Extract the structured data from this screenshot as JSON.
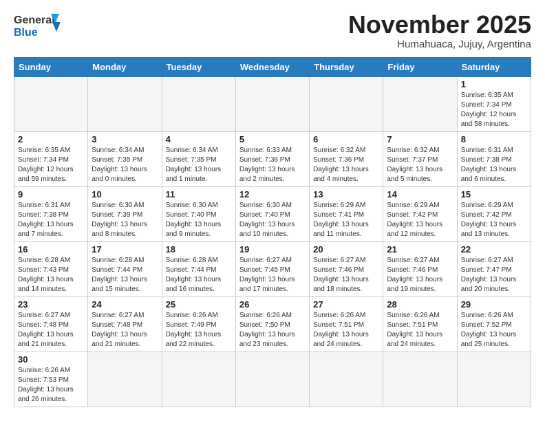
{
  "logo": {
    "line1": "General",
    "line2": "Blue"
  },
  "title": "November 2025",
  "subtitle": "Humahuaca, Jujuy, Argentina",
  "weekdays": [
    "Sunday",
    "Monday",
    "Tuesday",
    "Wednesday",
    "Thursday",
    "Friday",
    "Saturday"
  ],
  "weeks": [
    [
      {
        "day": "",
        "info": ""
      },
      {
        "day": "",
        "info": ""
      },
      {
        "day": "",
        "info": ""
      },
      {
        "day": "",
        "info": ""
      },
      {
        "day": "",
        "info": ""
      },
      {
        "day": "",
        "info": ""
      },
      {
        "day": "1",
        "info": "Sunrise: 6:35 AM\nSunset: 7:34 PM\nDaylight: 12 hours\nand 58 minutes."
      }
    ],
    [
      {
        "day": "2",
        "info": "Sunrise: 6:35 AM\nSunset: 7:34 PM\nDaylight: 12 hours\nand 59 minutes."
      },
      {
        "day": "3",
        "info": "Sunrise: 6:34 AM\nSunset: 7:35 PM\nDaylight: 13 hours\nand 0 minutes."
      },
      {
        "day": "4",
        "info": "Sunrise: 6:34 AM\nSunset: 7:35 PM\nDaylight: 13 hours\nand 1 minute."
      },
      {
        "day": "5",
        "info": "Sunrise: 6:33 AM\nSunset: 7:36 PM\nDaylight: 13 hours\nand 2 minutes."
      },
      {
        "day": "6",
        "info": "Sunrise: 6:32 AM\nSunset: 7:36 PM\nDaylight: 13 hours\nand 4 minutes."
      },
      {
        "day": "7",
        "info": "Sunrise: 6:32 AM\nSunset: 7:37 PM\nDaylight: 13 hours\nand 5 minutes."
      },
      {
        "day": "8",
        "info": "Sunrise: 6:31 AM\nSunset: 7:38 PM\nDaylight: 13 hours\nand 6 minutes."
      }
    ],
    [
      {
        "day": "9",
        "info": "Sunrise: 6:31 AM\nSunset: 7:38 PM\nDaylight: 13 hours\nand 7 minutes."
      },
      {
        "day": "10",
        "info": "Sunrise: 6:30 AM\nSunset: 7:39 PM\nDaylight: 13 hours\nand 8 minutes."
      },
      {
        "day": "11",
        "info": "Sunrise: 6:30 AM\nSunset: 7:40 PM\nDaylight: 13 hours\nand 9 minutes."
      },
      {
        "day": "12",
        "info": "Sunrise: 6:30 AM\nSunset: 7:40 PM\nDaylight: 13 hours\nand 10 minutes."
      },
      {
        "day": "13",
        "info": "Sunrise: 6:29 AM\nSunset: 7:41 PM\nDaylight: 13 hours\nand 11 minutes."
      },
      {
        "day": "14",
        "info": "Sunrise: 6:29 AM\nSunset: 7:42 PM\nDaylight: 13 hours\nand 12 minutes."
      },
      {
        "day": "15",
        "info": "Sunrise: 6:29 AM\nSunset: 7:42 PM\nDaylight: 13 hours\nand 13 minutes."
      }
    ],
    [
      {
        "day": "16",
        "info": "Sunrise: 6:28 AM\nSunset: 7:43 PM\nDaylight: 13 hours\nand 14 minutes."
      },
      {
        "day": "17",
        "info": "Sunrise: 6:28 AM\nSunset: 7:44 PM\nDaylight: 13 hours\nand 15 minutes."
      },
      {
        "day": "18",
        "info": "Sunrise: 6:28 AM\nSunset: 7:44 PM\nDaylight: 13 hours\nand 16 minutes."
      },
      {
        "day": "19",
        "info": "Sunrise: 6:27 AM\nSunset: 7:45 PM\nDaylight: 13 hours\nand 17 minutes."
      },
      {
        "day": "20",
        "info": "Sunrise: 6:27 AM\nSunset: 7:46 PM\nDaylight: 13 hours\nand 18 minutes."
      },
      {
        "day": "21",
        "info": "Sunrise: 6:27 AM\nSunset: 7:46 PM\nDaylight: 13 hours\nand 19 minutes."
      },
      {
        "day": "22",
        "info": "Sunrise: 6:27 AM\nSunset: 7:47 PM\nDaylight: 13 hours\nand 20 minutes."
      }
    ],
    [
      {
        "day": "23",
        "info": "Sunrise: 6:27 AM\nSunset: 7:48 PM\nDaylight: 13 hours\nand 21 minutes."
      },
      {
        "day": "24",
        "info": "Sunrise: 6:27 AM\nSunset: 7:48 PM\nDaylight: 13 hours\nand 21 minutes."
      },
      {
        "day": "25",
        "info": "Sunrise: 6:26 AM\nSunset: 7:49 PM\nDaylight: 13 hours\nand 22 minutes."
      },
      {
        "day": "26",
        "info": "Sunrise: 6:26 AM\nSunset: 7:50 PM\nDaylight: 13 hours\nand 23 minutes."
      },
      {
        "day": "27",
        "info": "Sunrise: 6:26 AM\nSunset: 7:51 PM\nDaylight: 13 hours\nand 24 minutes."
      },
      {
        "day": "28",
        "info": "Sunrise: 6:26 AM\nSunset: 7:51 PM\nDaylight: 13 hours\nand 24 minutes."
      },
      {
        "day": "29",
        "info": "Sunrise: 6:26 AM\nSunset: 7:52 PM\nDaylight: 13 hours\nand 25 minutes."
      }
    ],
    [
      {
        "day": "30",
        "info": "Sunrise: 6:26 AM\nSunset: 7:53 PM\nDaylight: 13 hours\nand 26 minutes."
      },
      {
        "day": "",
        "info": ""
      },
      {
        "day": "",
        "info": ""
      },
      {
        "day": "",
        "info": ""
      },
      {
        "day": "",
        "info": ""
      },
      {
        "day": "",
        "info": ""
      },
      {
        "day": "",
        "info": ""
      }
    ]
  ]
}
